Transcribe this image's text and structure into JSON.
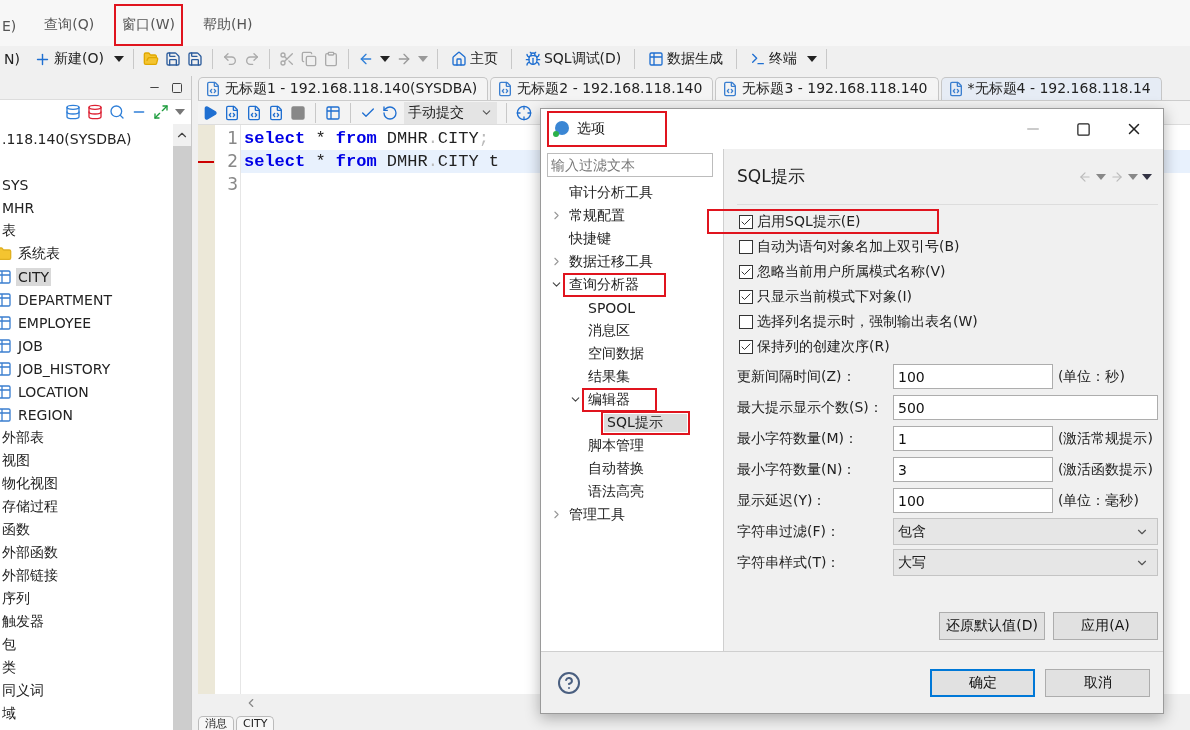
{
  "menu_bar": {
    "items": [
      {
        "label": "E)",
        "annotated": false
      },
      {
        "label": "查询(Q)",
        "annotated": false
      },
      {
        "label": "窗口(W)",
        "annotated": true
      },
      {
        "label": "帮助(H)",
        "annotated": false
      }
    ]
  },
  "toolbar": {
    "items": [
      {
        "kind": "text",
        "label": "N)"
      },
      {
        "kind": "new",
        "label": "新建(O)"
      },
      {
        "kind": "home",
        "label": "主页"
      },
      {
        "kind": "debug",
        "label": "SQL调试(D)"
      },
      {
        "kind": "generate",
        "label": "数据生成"
      },
      {
        "kind": "terminal",
        "label": "终端"
      }
    ]
  },
  "object_tree": {
    "items": [
      {
        "kind": "node",
        "label": ".118.140(SYSDBA)",
        "selected": false,
        "children": [
          {
            "kind": "node",
            "label": "SYS",
            "selected": false
          },
          {
            "kind": "node",
            "label": "MHR",
            "selected": false,
            "children": [
              {
                "kind": "node",
                "label": "表",
                "selected": false,
                "children": [
                  {
                    "kind": "folder",
                    "label": "系统表",
                    "selected": false
                  },
                  {
                    "kind": "table",
                    "label": "CITY",
                    "selected": true
                  },
                  {
                    "kind": "table",
                    "label": "DEPARTMENT",
                    "selected": false
                  },
                  {
                    "kind": "table",
                    "label": "EMPLOYEE",
                    "selected": false
                  },
                  {
                    "kind": "table",
                    "label": "JOB",
                    "selected": false
                  },
                  {
                    "kind": "table",
                    "label": "JOB_HISTORY",
                    "selected": false
                  },
                  {
                    "kind": "table",
                    "label": "LOCATION",
                    "selected": false
                  },
                  {
                    "kind": "table",
                    "label": "REGION",
                    "selected": false
                  }
                ]
              },
              {
                "kind": "node",
                "label": "外部表",
                "selected": false
              },
              {
                "kind": "node",
                "label": "视图",
                "selected": false
              },
              {
                "kind": "node",
                "label": "物化视图",
                "selected": false
              },
              {
                "kind": "node",
                "label": "存储过程",
                "selected": false
              },
              {
                "kind": "node",
                "label": "函数",
                "selected": false
              },
              {
                "kind": "node",
                "label": "外部函数",
                "selected": false
              },
              {
                "kind": "node",
                "label": "外部链接",
                "selected": false
              },
              {
                "kind": "node",
                "label": "序列",
                "selected": false
              },
              {
                "kind": "node",
                "label": "触发器",
                "selected": false
              },
              {
                "kind": "node",
                "label": "包",
                "selected": false
              },
              {
                "kind": "node",
                "label": "类",
                "selected": false
              },
              {
                "kind": "node",
                "label": "同义词",
                "selected": false
              },
              {
                "kind": "node",
                "label": "域",
                "selected": false
              }
            ]
          }
        ]
      }
    ]
  },
  "editor_tabs": [
    {
      "label": "无标题1 - 192.168.118.140(SYSDBA)",
      "selected": false
    },
    {
      "label": "无标题2 - 192.168.118.140",
      "selected": false
    },
    {
      "label": "无标题3 - 192.168.118.140",
      "selected": false
    },
    {
      "label": "*无标题4 - 192.168.118.14",
      "selected": true
    }
  ],
  "editor_toolbar": {
    "commit_mode": "手动提交"
  },
  "editor": {
    "lines": [
      {
        "number": "1",
        "current": false,
        "tokens": [
          {
            "kind": "keyword",
            "text": "select"
          },
          {
            "kind": "plain",
            "text": " * "
          },
          {
            "kind": "keyword",
            "text": "from"
          },
          {
            "kind": "plain",
            "text": " DMHR"
          },
          {
            "kind": "punct",
            "text": "."
          },
          {
            "kind": "plain",
            "text": "CITY"
          },
          {
            "kind": "punct",
            "text": ";"
          }
        ]
      },
      {
        "number": "2",
        "current": true,
        "marked": true,
        "tokens": [
          {
            "kind": "keyword",
            "text": "select"
          },
          {
            "kind": "plain",
            "text": " * "
          },
          {
            "kind": "keyword",
            "text": "from"
          },
          {
            "kind": "plain",
            "text": " DMHR"
          },
          {
            "kind": "punct",
            "text": "."
          },
          {
            "kind": "plain",
            "text": "CITY t"
          }
        ]
      },
      {
        "number": "3",
        "current": false
      }
    ]
  },
  "bottom_tabs": [
    {
      "label": "消息"
    },
    {
      "label": "CITY"
    }
  ],
  "dialog": {
    "title": "选项",
    "title_annotated": true,
    "filter": {
      "placeholder": "输入过滤文本"
    },
    "tree": [
      {
        "label": "审计分析工具",
        "selected": false,
        "annotated": false
      },
      {
        "label": "常规配置",
        "expanded": false,
        "selected": false,
        "annotated": false
      },
      {
        "label": "快捷键",
        "selected": false,
        "annotated": false
      },
      {
        "label": "数据迁移工具",
        "expanded": false,
        "selected": false,
        "annotated": false
      },
      {
        "label": "查询分析器",
        "expanded": true,
        "selected": false,
        "annotated": true,
        "children": [
          {
            "label": "SPOOL",
            "selected": false,
            "annotated": false
          },
          {
            "label": "消息区",
            "selected": false,
            "annotated": false
          },
          {
            "label": "空间数据",
            "selected": false,
            "annotated": false
          },
          {
            "label": "结果集",
            "selected": false,
            "annotated": false
          },
          {
            "label": "编辑器",
            "expanded": true,
            "selected": false,
            "annotated": true,
            "children": [
              {
                "label": "SQL提示",
                "selected": true,
                "annotated": true
              }
            ]
          },
          {
            "label": "脚本管理",
            "selected": false,
            "annotated": false
          },
          {
            "label": "自动替换",
            "selected": false,
            "annotated": false
          },
          {
            "label": "语法高亮",
            "selected": false,
            "annotated": false
          }
        ]
      },
      {
        "label": "管理工具",
        "expanded": false,
        "selected": false,
        "annotated": false
      }
    ],
    "page": {
      "title": "SQL提示",
      "checkboxes": [
        {
          "label": "启用SQL提示(E)",
          "checked": true,
          "annotated": true
        },
        {
          "label": "自动为语句对象名加上双引号(B)",
          "checked": false,
          "annotated": false
        },
        {
          "label": "忽略当前用户所属模式名称(V)",
          "checked": true,
          "annotated": false
        },
        {
          "label": "只显示当前模式下对象(I)",
          "checked": true,
          "annotated": false
        },
        {
          "label": "选择列名提示时，强制输出表名(W)",
          "checked": false,
          "annotated": false
        },
        {
          "label": "保持列的创建次序(R)",
          "checked": true,
          "annotated": false
        }
      ],
      "fields": [
        {
          "kind": "text",
          "label": "更新间隔时间(Z)：",
          "value": "100",
          "unit": "(单位：秒)"
        },
        {
          "kind": "text",
          "label": "最大提示显示个数(S)：",
          "value": "500"
        },
        {
          "kind": "text",
          "label": "最小字符数量(M)：",
          "value": "1",
          "unit": "(激活常规提示)"
        },
        {
          "kind": "text",
          "label": "最小字符数量(N)：",
          "value": "3",
          "unit": "(激活函数提示)"
        },
        {
          "kind": "text",
          "label": "显示延迟(Y)：",
          "value": "100",
          "unit": "(单位：毫秒)"
        },
        {
          "kind": "select",
          "label": "字符串过滤(F)：",
          "value": "包含"
        },
        {
          "kind": "select",
          "label": "字符串样式(T)：",
          "value": "大写"
        }
      ],
      "buttons": [
        "还原默认值(D)",
        "应用(A)"
      ]
    },
    "footer_buttons": [
      {
        "label": "确定",
        "default": true
      },
      {
        "label": "取消",
        "default": false
      }
    ]
  }
}
